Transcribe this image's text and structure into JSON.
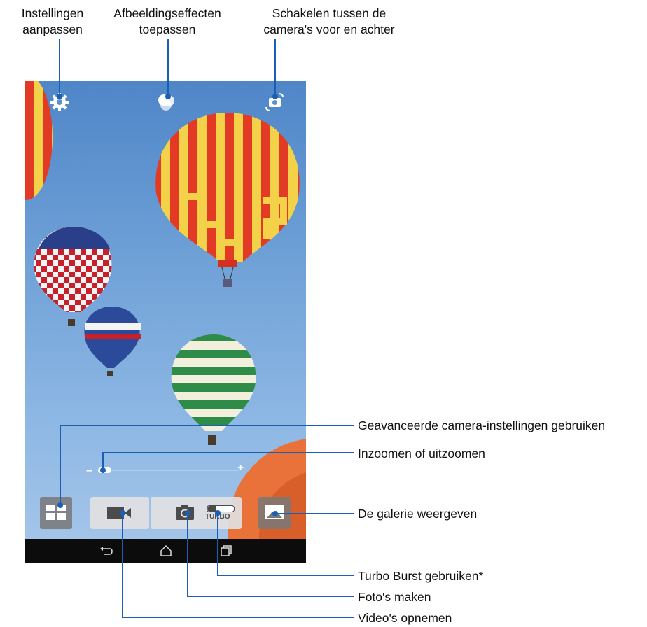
{
  "callouts": {
    "settings": [
      "Instellingen",
      "aanpassen"
    ],
    "effects": [
      "Afbeeldingseffecten",
      "toepassen"
    ],
    "switch_camera": [
      "Schakelen tussen de",
      "camera's voor en achter"
    ],
    "advanced": "Geavanceerde camera-instellingen gebruiken",
    "zoom": "Inzoomen of uitzoomen",
    "gallery": "De galerie weergeven",
    "turbo": "Turbo Burst gebruiken*",
    "photo": "Foto's maken",
    "video": "Video's opnemen"
  },
  "camera_ui": {
    "zoom_minus": "–",
    "zoom_plus": "+",
    "turbo_label": "TURBO",
    "zoom_level": 0.05
  },
  "icons": {
    "settings": "gear-icon",
    "effects": "effects-icon",
    "switch": "switch-camera-icon",
    "advanced": "grid-icon",
    "video": "video-camera-icon",
    "photo": "camera-icon",
    "gallery": "gallery-icon",
    "back": "back-icon",
    "home": "home-icon",
    "recents": "recents-icon"
  },
  "colors": {
    "sky": "#6d9fd6",
    "navbar": "#0c0c0c",
    "button_light": "#e1e1e1",
    "button_dark": "#787878"
  }
}
